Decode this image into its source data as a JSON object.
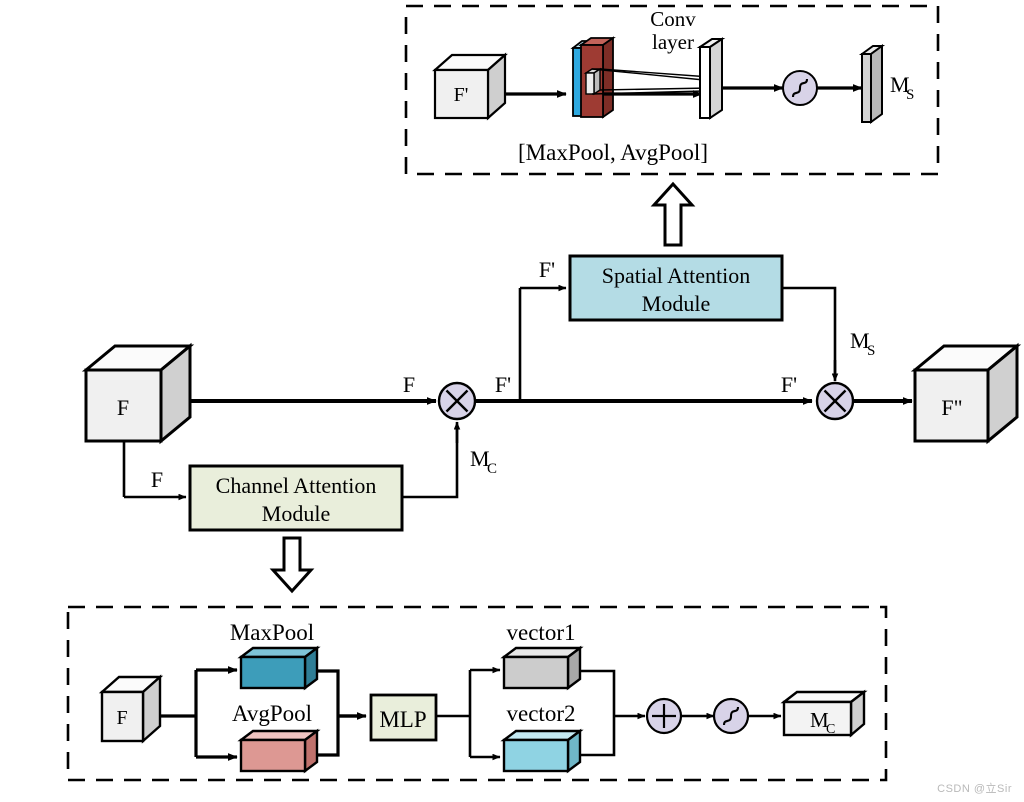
{
  "figure": {
    "title": "CBAM: Convolutional Block Attention Module diagram",
    "watermark": "CSDN @立Sir"
  },
  "colors": {
    "background": "#ffffff",
    "stroke": "#000000",
    "cube_face": "#f0f0f0",
    "cube_top": "#fbfbfb",
    "cube_side": "#d0d0d0",
    "channel_module_fill": "#e9eedb",
    "spatial_module_fill": "#b4dce5",
    "mlp_fill": "#e9eedb",
    "maxpool_fill": "#3d9dba",
    "maxpool_top": "#7ec4d8",
    "maxpool_side": "#2f7e96",
    "avgpool_fill": "#dd9893",
    "avgpool_top": "#f0c4c1",
    "avgpool_side": "#c0726d",
    "vector1_fill": "#cccccc",
    "vector1_top": "#e8e8e8",
    "vector1_side": "#a8a8a8",
    "vector2_fill": "#8fd3e3",
    "vector2_top": "#c3e9f2",
    "vector2_side": "#6fb6c7",
    "operator_fill": "#d8d3e8",
    "conv_blue": "#2ea9e0",
    "conv_red": "#9e3b33",
    "conv_red_top": "#c2635a",
    "plate_fill": "#d4d4d4",
    "plate_white": "#ffffff"
  },
  "spatial_detail": {
    "name": "Spatial Attention Module detail",
    "input_cube_label": "F'",
    "conv_label_line1": "Conv",
    "conv_label_line2": "layer",
    "pool_label": "[MaxPool, AvgPool]",
    "sigmoid_label": "sigmoid",
    "output_label": "M",
    "output_sub": "S"
  },
  "channel_detail": {
    "name": "Channel Attention Module detail",
    "input_cube_label": "F",
    "maxpool_label": "MaxPool",
    "avgpool_label": "AvgPool",
    "mlp_label": "MLP",
    "vector1_label": "vector1",
    "vector2_label": "vector2",
    "plus_label": "sum",
    "sigmoid_label": "sigmoid",
    "output_label": "M",
    "output_sub": "C"
  },
  "main_flow": {
    "input_cube_label": "F",
    "output_cube_label": "F\"",
    "channel_module_line1": "Channel Attention",
    "channel_module_line2": "Module",
    "spatial_module_line1": "Spatial Attention",
    "spatial_module_line2": "Module",
    "edge_f_to_mul": "F",
    "edge_f_to_channel": "F",
    "edge_mc": "M",
    "edge_mc_sub": "C",
    "edge_fprime_after_mul": "F'",
    "edge_fprime_to_spatial": "F'",
    "edge_fprime_to_mul2": "F'",
    "edge_ms": "M",
    "edge_ms_sub": "S",
    "multiply_1": "multiply",
    "multiply_2": "multiply"
  }
}
